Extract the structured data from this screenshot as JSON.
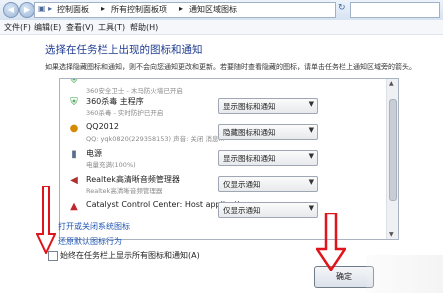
{
  "address": {
    "crumbs": [
      "控制面板",
      "所有控制面板项",
      "通知区域图标"
    ],
    "search_placeholder": ""
  },
  "menu": [
    "文件(F)",
    "编辑(E)",
    "查看(V)",
    "工具(T)",
    "帮助(H)"
  ],
  "heading": "选择在任务栏上出现的图标和通知",
  "description": "如果选择隐藏图标和通知，则不会向您通知更改和更新。若要随时查看隐藏的图标，请单击任务栏上通知区域旁的箭头。",
  "rows": [
    {
      "name": "",
      "sub": "360安全卫士 - 木马防火墙已开启",
      "setting": "",
      "icon": "shield-icon"
    },
    {
      "name": "360杀毒 主程序",
      "sub": "360杀毒 - 实时防护已开启",
      "setting": "显示图标和通知",
      "icon": "shield-icon"
    },
    {
      "name": "QQ2012",
      "sub": "QQ: yqk0820(229358153) 声音: 关闭 消息...",
      "setting": "隐藏图标和通知",
      "icon": "qq-penguin-icon"
    },
    {
      "name": "电源",
      "sub": "电量充满(100%)",
      "setting": "显示图标和通知",
      "icon": "battery-icon"
    },
    {
      "name": "Realtek高清晰音频管理器",
      "sub": "Realtek高清晰音频管理器",
      "setting": "仅显示通知",
      "icon": "speaker-icon"
    },
    {
      "name": "Catalyst Control Center: Host application",
      "sub": "",
      "setting": "仅显示通知",
      "icon": "catalyst-icon"
    }
  ],
  "links": {
    "system_icons": "打开或关闭系统图标",
    "restore": "还原默认图标行为"
  },
  "checkbox_label": "始终在任务栏上显示所有图标和通知(A)",
  "ok_button": "确定",
  "colors": {
    "heading": "#1e3b91",
    "link": "#1f56b3",
    "arrow": "#e0141b"
  }
}
